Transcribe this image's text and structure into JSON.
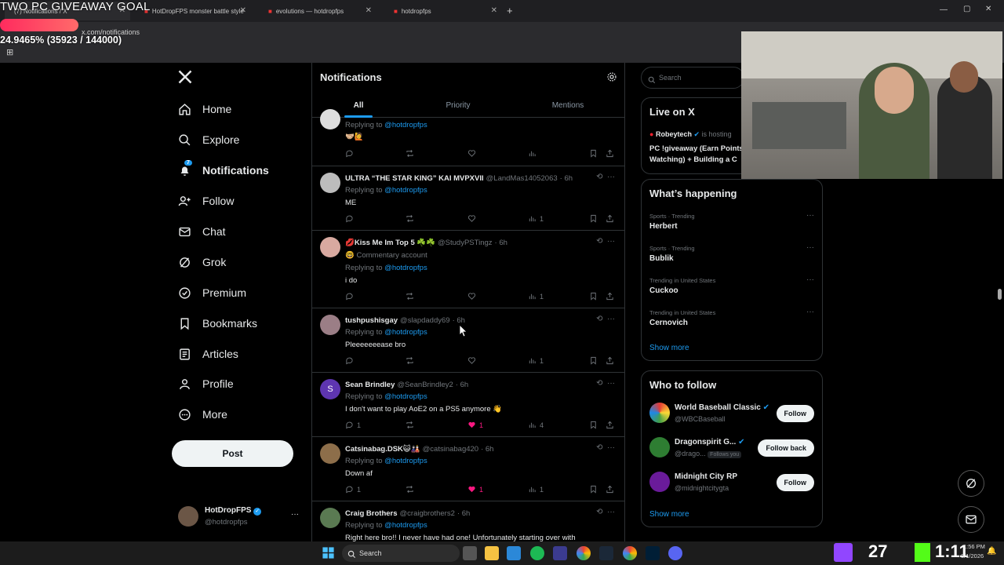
{
  "overlay": {
    "goal_title": "TWO PC GIVEAWAY GOAL",
    "progress_text": "24.9465% (35923 / 144000)",
    "progress_fraction": 0.249465
  },
  "browser": {
    "tabs": [
      {
        "label": "(7) Notifications / X"
      },
      {
        "label": "HotDropFPS monster battle style"
      },
      {
        "label": "evolutions — hotdropfps"
      },
      {
        "label": "hotdropfps"
      }
    ],
    "new_tab": "+",
    "url": "x.com/notifications"
  },
  "nav": {
    "logo": "X",
    "items": [
      {
        "label": "Home",
        "icon": "home-icon"
      },
      {
        "label": "Explore",
        "icon": "search-icon"
      },
      {
        "label": "Notifications",
        "icon": "bell-icon",
        "badge": "7"
      },
      {
        "label": "Follow",
        "icon": "person-add-icon"
      },
      {
        "label": "Chat",
        "icon": "mail-icon"
      },
      {
        "label": "Grok",
        "icon": "grok-icon"
      },
      {
        "label": "Premium",
        "icon": "verified-icon"
      },
      {
        "label": "Bookmarks",
        "icon": "bookmark-icon"
      },
      {
        "label": "Articles",
        "icon": "article-icon"
      },
      {
        "label": "Profile",
        "icon": "person-icon"
      },
      {
        "label": "More",
        "icon": "more-circle-icon"
      }
    ],
    "post_label": "Post",
    "account": {
      "name": "HotDropFPS",
      "handle": "@hotdropfps",
      "more": "···"
    }
  },
  "center": {
    "title": "Notifications",
    "tabs": [
      "All",
      "Priority",
      "Mentions"
    ],
    "replies": [
      {
        "name": "",
        "handle": "",
        "time": "",
        "sub": "",
        "replying": "Replying to",
        "mention": "@hotdropfps",
        "text": "🤝🏼🙋",
        "counts": {
          "reply": "",
          "repost": "",
          "like": "",
          "views": ""
        }
      },
      {
        "name": "ULTRA “THE STAR KING” KAI MVPXVII",
        "handle": "@LandMas14052063",
        "time": "· 6h",
        "sub": "",
        "replying": "Replying to",
        "mention": "@hotdropfps",
        "text": "ME",
        "counts": {
          "reply": "",
          "repost": "",
          "like": "",
          "views": "1"
        }
      },
      {
        "name": "💋Kiss Me Im Top 5 ☘️☘️",
        "handle": "@StudyPSTingz",
        "time": "· 6h",
        "sub": "🤓 Commentary account",
        "replying": "Replying to",
        "mention": "@hotdropfps",
        "text": "i do",
        "counts": {
          "reply": "",
          "repost": "",
          "like": "",
          "views": "1"
        }
      },
      {
        "name": "tushpushisgay",
        "handle": "@slapdaddy69",
        "time": "· 6h",
        "sub": "",
        "replying": "Replying to",
        "mention": "@hotdropfps",
        "text": "Pleeeeeeease bro",
        "counts": {
          "reply": "",
          "repost": "",
          "like": "",
          "views": "1"
        }
      },
      {
        "name": "Sean Brindley",
        "handle": "@SeanBrindley2",
        "time": "· 6h",
        "sub": "",
        "replying": "Replying to",
        "mention": "@hotdropfps",
        "text": "I don't want to play AoE2 on a PS5 anymore 👋",
        "counts": {
          "reply": "1",
          "repost": "",
          "like": "1",
          "views": "4"
        }
      },
      {
        "name": "Catsinabag.DSK😺🎎",
        "handle": "@catsinabag420",
        "time": "· 6h",
        "sub": "",
        "replying": "Replying to",
        "mention": "@hotdropfps",
        "text": "Down af",
        "counts": {
          "reply": "1",
          "repost": "",
          "like": "1",
          "views": "1"
        }
      },
      {
        "name": "Craig Brothers",
        "handle": "@craigbrothers2",
        "time": "· 6h",
        "sub": "",
        "replying": "Replying to",
        "mention": "@hotdropfps",
        "text": "Right here bro!! I never have had one! Unfortunately starting over with",
        "counts": {
          "reply": "",
          "repost": "",
          "like": "",
          "views": ""
        }
      }
    ]
  },
  "right": {
    "search_placeholder": "Search",
    "live": {
      "title": "Live on X",
      "host": "Robeytech",
      "hosting": "is hosting",
      "line1": "PC !giveaway (Earn Points",
      "line2": "Watching) + Building a C"
    },
    "happening": {
      "title": "What’s happening",
      "trends": [
        {
          "meta": "Sports · Trending",
          "name": "Herbert"
        },
        {
          "meta": "Sports · Trending",
          "name": "Bublik"
        },
        {
          "meta": "Trending in United States",
          "name": "Cuckoo"
        },
        {
          "meta": "Trending in United States",
          "name": "Cernovich"
        }
      ],
      "show_more": "Show more"
    },
    "who_to_follow": {
      "title": "Who to follow",
      "accounts": [
        {
          "name": "World Baseball Classic",
          "handle": "@WBCBaseball",
          "button": "Follow",
          "follows_you": ""
        },
        {
          "name": "Dragonspirit G...",
          "handle": "@drago...",
          "button": "Follow back",
          "follows_you": "Follows you"
        },
        {
          "name": "Midnight City RP",
          "handle": "@midnightcitygta",
          "button": "Follow",
          "follows_you": ""
        }
      ],
      "show_more": "Show more"
    }
  },
  "taskbar": {
    "search_label": "Search",
    "tray_number": "27",
    "clock_time": "1:56 PM",
    "clock_date": "3/1/2026",
    "big_overlay": "1:11"
  },
  "colors": {
    "accent": "#1d9bf0",
    "like": "#f91880",
    "bg": "#000000"
  }
}
